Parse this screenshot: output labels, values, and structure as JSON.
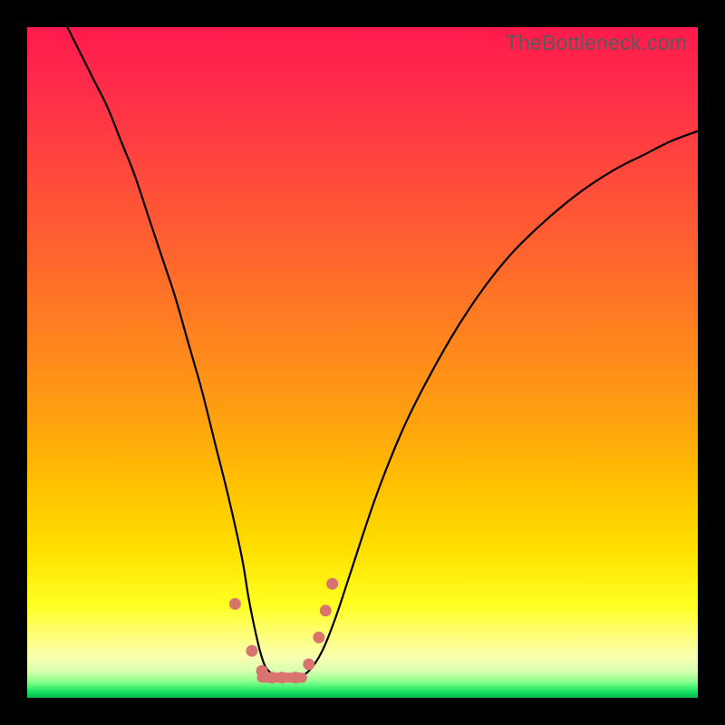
{
  "watermark": "TheBottleneck.com",
  "chart_data": {
    "type": "line",
    "title": "",
    "xlabel": "",
    "ylabel": "",
    "xlim": [
      0,
      100
    ],
    "ylim": [
      0,
      100
    ],
    "x": [
      6,
      8,
      10,
      12,
      14,
      16,
      18,
      20,
      22,
      24,
      26,
      28,
      30,
      32,
      33,
      34,
      35,
      36,
      38,
      40,
      42,
      44,
      46,
      48,
      52,
      56,
      60,
      64,
      68,
      72,
      76,
      80,
      84,
      88,
      92,
      96,
      100
    ],
    "y": [
      100,
      96,
      92,
      88,
      83,
      78,
      72,
      66,
      60,
      53,
      46,
      38,
      30,
      21,
      15,
      10,
      6,
      4,
      3,
      3,
      4,
      7,
      12,
      18,
      30,
      40,
      48,
      55,
      61,
      66,
      70,
      73.5,
      76.5,
      79,
      81,
      83,
      84.5
    ],
    "markers_x": [
      31,
      33.5,
      35,
      36.5,
      38,
      40,
      42,
      43.5,
      44.5,
      45.5
    ],
    "markers_y": [
      14,
      7,
      4,
      3,
      3,
      3,
      5,
      9,
      13,
      17
    ],
    "flat_segment": {
      "x0": 35,
      "x1": 41,
      "y": 3
    },
    "gradient_stops": [
      {
        "pos": 0,
        "color": "#ff1a4d"
      },
      {
        "pos": 50,
        "color": "#ff9018"
      },
      {
        "pos": 86,
        "color": "#ffff20"
      },
      {
        "pos": 98,
        "color": "#40f070"
      },
      {
        "pos": 100,
        "color": "#08b850"
      }
    ]
  }
}
